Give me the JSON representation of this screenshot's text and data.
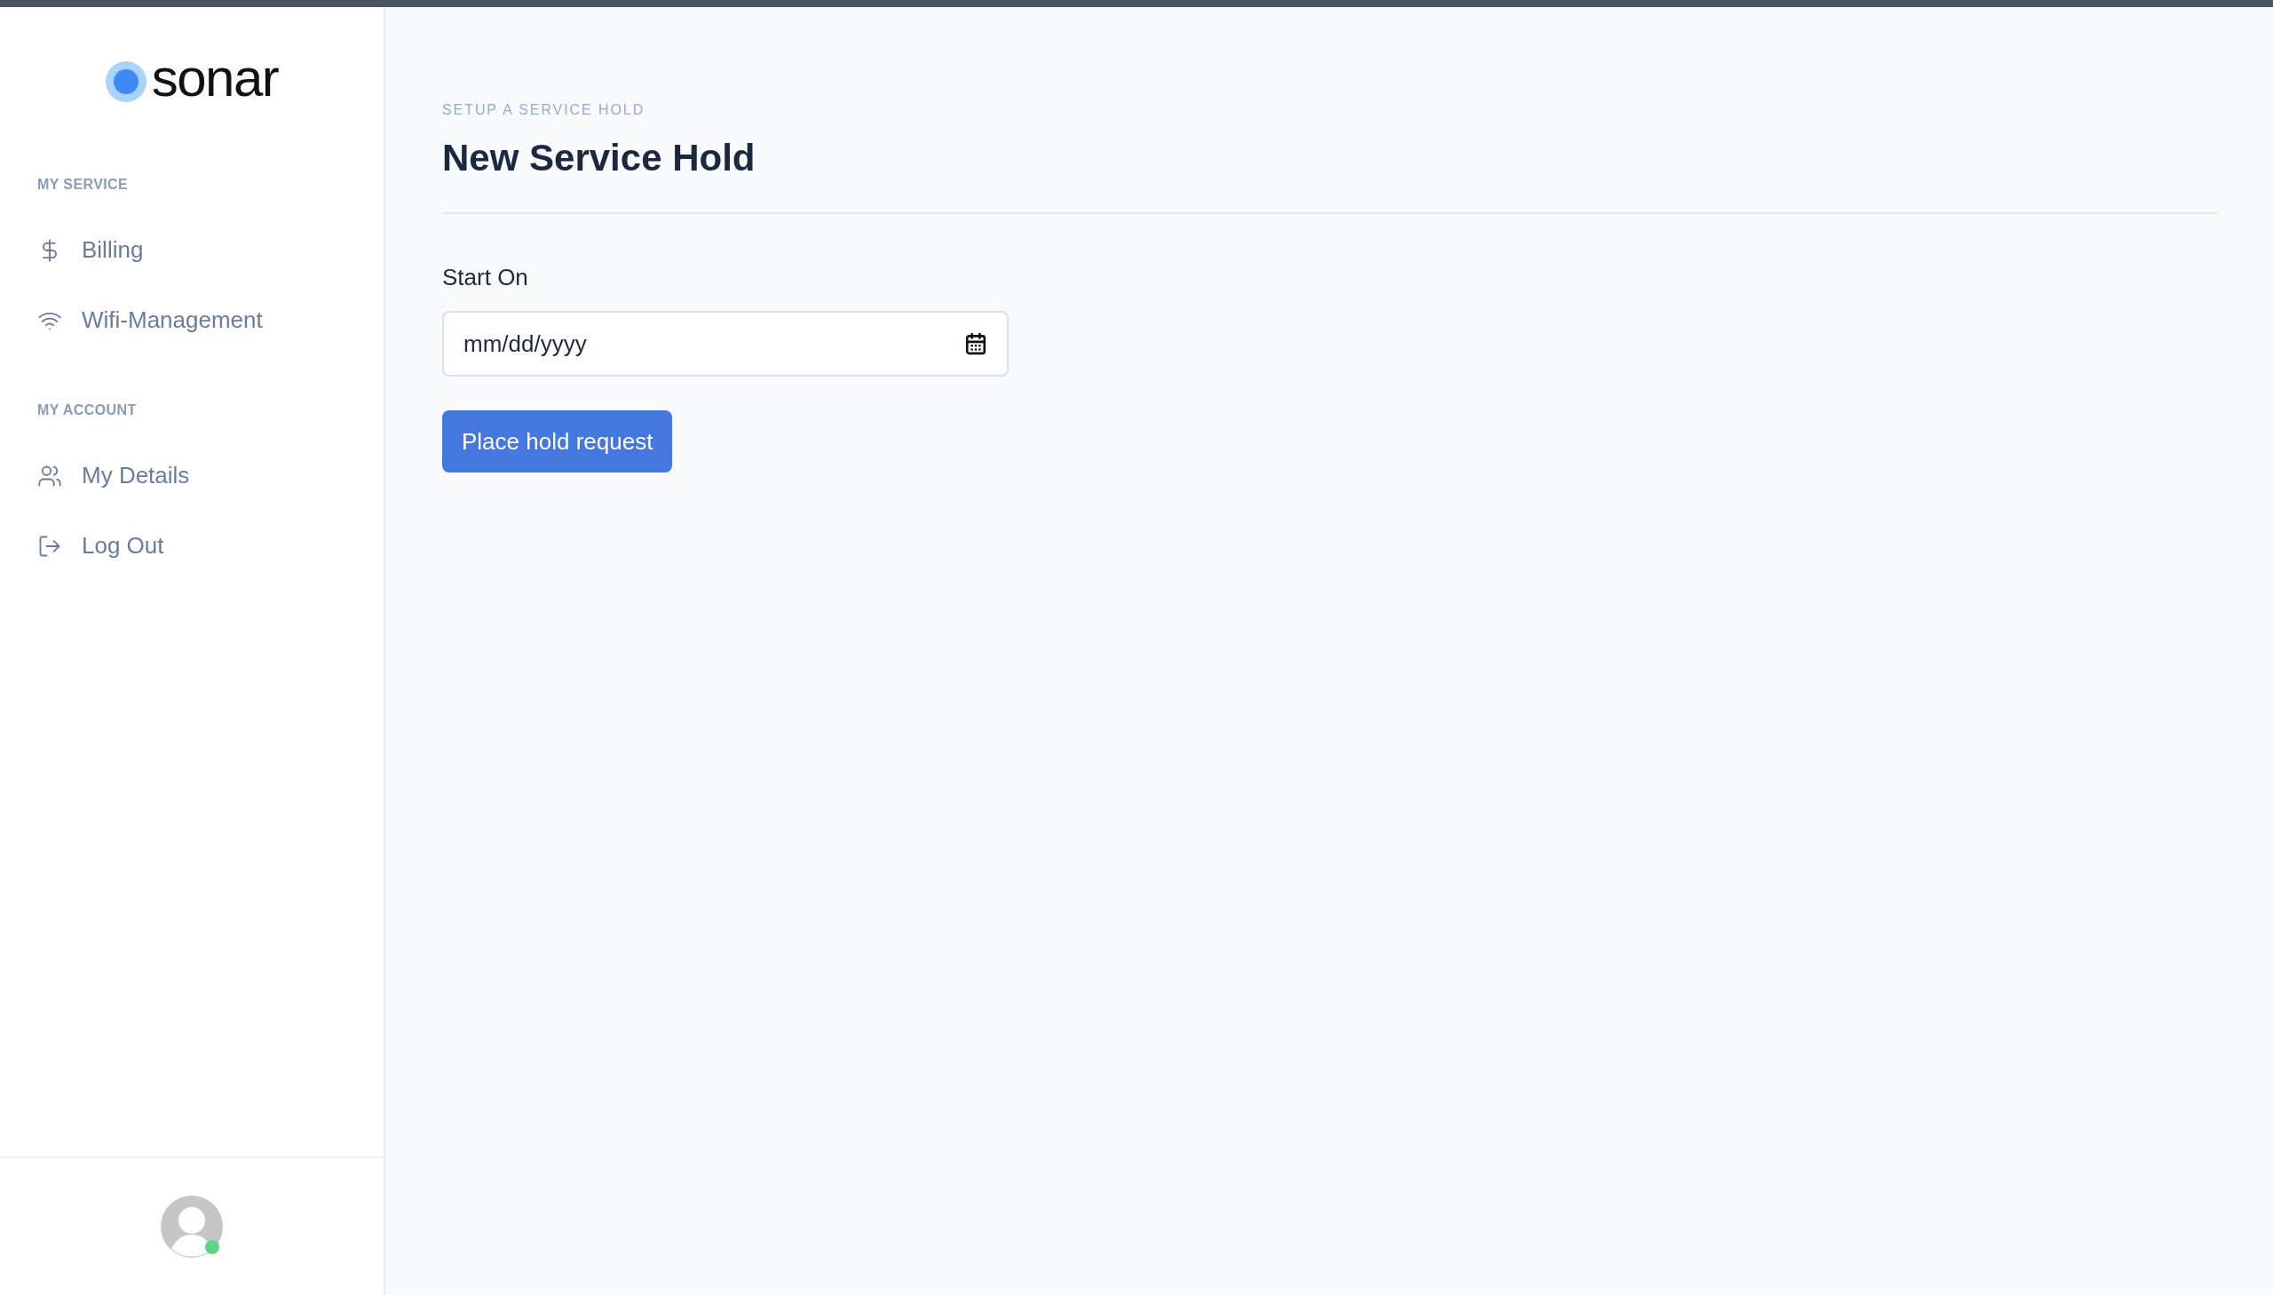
{
  "sidebar": {
    "logo": "sonar",
    "sections": [
      {
        "heading": "MY SERVICE",
        "items": [
          {
            "label": "Billing"
          },
          {
            "label": "Wifi-Management"
          }
        ]
      },
      {
        "heading": "MY ACCOUNT",
        "items": [
          {
            "label": "My Details"
          },
          {
            "label": "Log Out"
          }
        ]
      }
    ]
  },
  "page": {
    "eyebrow": "SETUP A SERVICE HOLD",
    "title": "New Service Hold"
  },
  "form": {
    "field": {
      "label": "Start On",
      "placeholder": "mm/dd/yyyy"
    },
    "submit": "Place hold request"
  }
}
